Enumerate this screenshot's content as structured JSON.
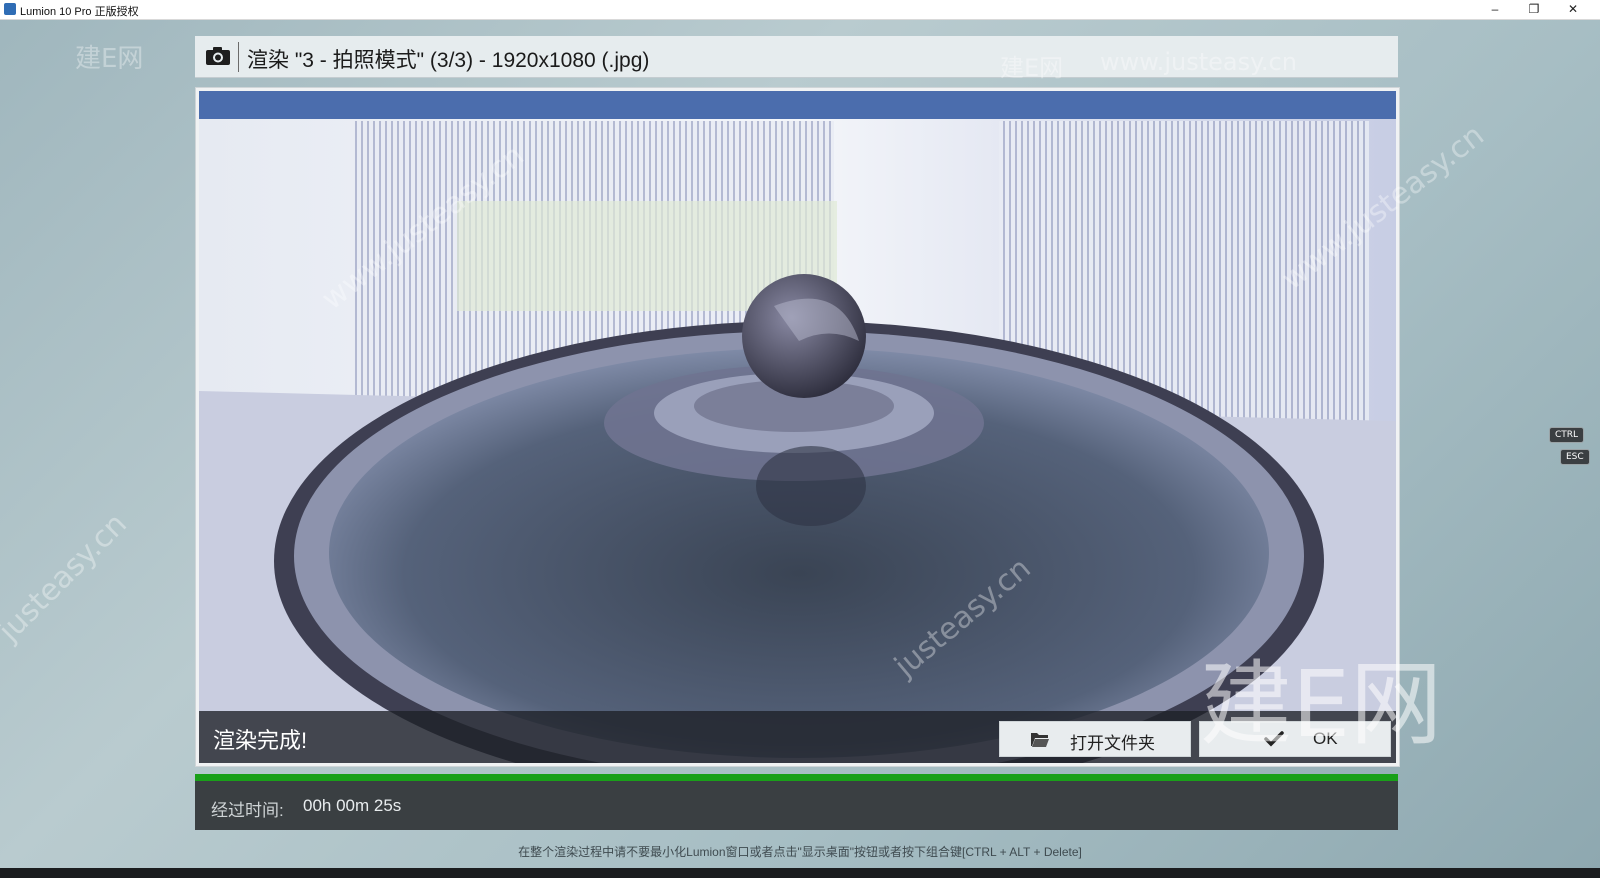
{
  "window": {
    "title": "Lumion 10 Pro 正版授权",
    "controls": {
      "minimize": "–",
      "restore": "❐",
      "close": "✕"
    }
  },
  "header": {
    "icon": "camera-icon",
    "title": "渲染 \"3 - 拍照模式\" (3/3) - 1920x1080 (.jpg)"
  },
  "render": {
    "status_text": "渲染完成!",
    "buttons": {
      "open_folder": {
        "label": "打开文件夹",
        "icon": "folder-open-icon"
      },
      "ok": {
        "label": "OK",
        "icon": "checkmark-icon"
      }
    }
  },
  "progress": {
    "percent": 100,
    "color": "#19a019"
  },
  "elapsed": {
    "label": "经过时间:",
    "value": "00h 00m 25s"
  },
  "footer_note": "在整个渲染过程中请不要最小化Lumion窗口或者点击\"显示桌面\"按钮或者按下组合键[CTRL + ALT + Delete]",
  "key_hints": {
    "ctrl": "CTRL",
    "esc": "ESC"
  },
  "watermarks": {
    "brand": "建E网",
    "url": "www.justeasy.cn",
    "url_short": "justeasy.cn"
  }
}
